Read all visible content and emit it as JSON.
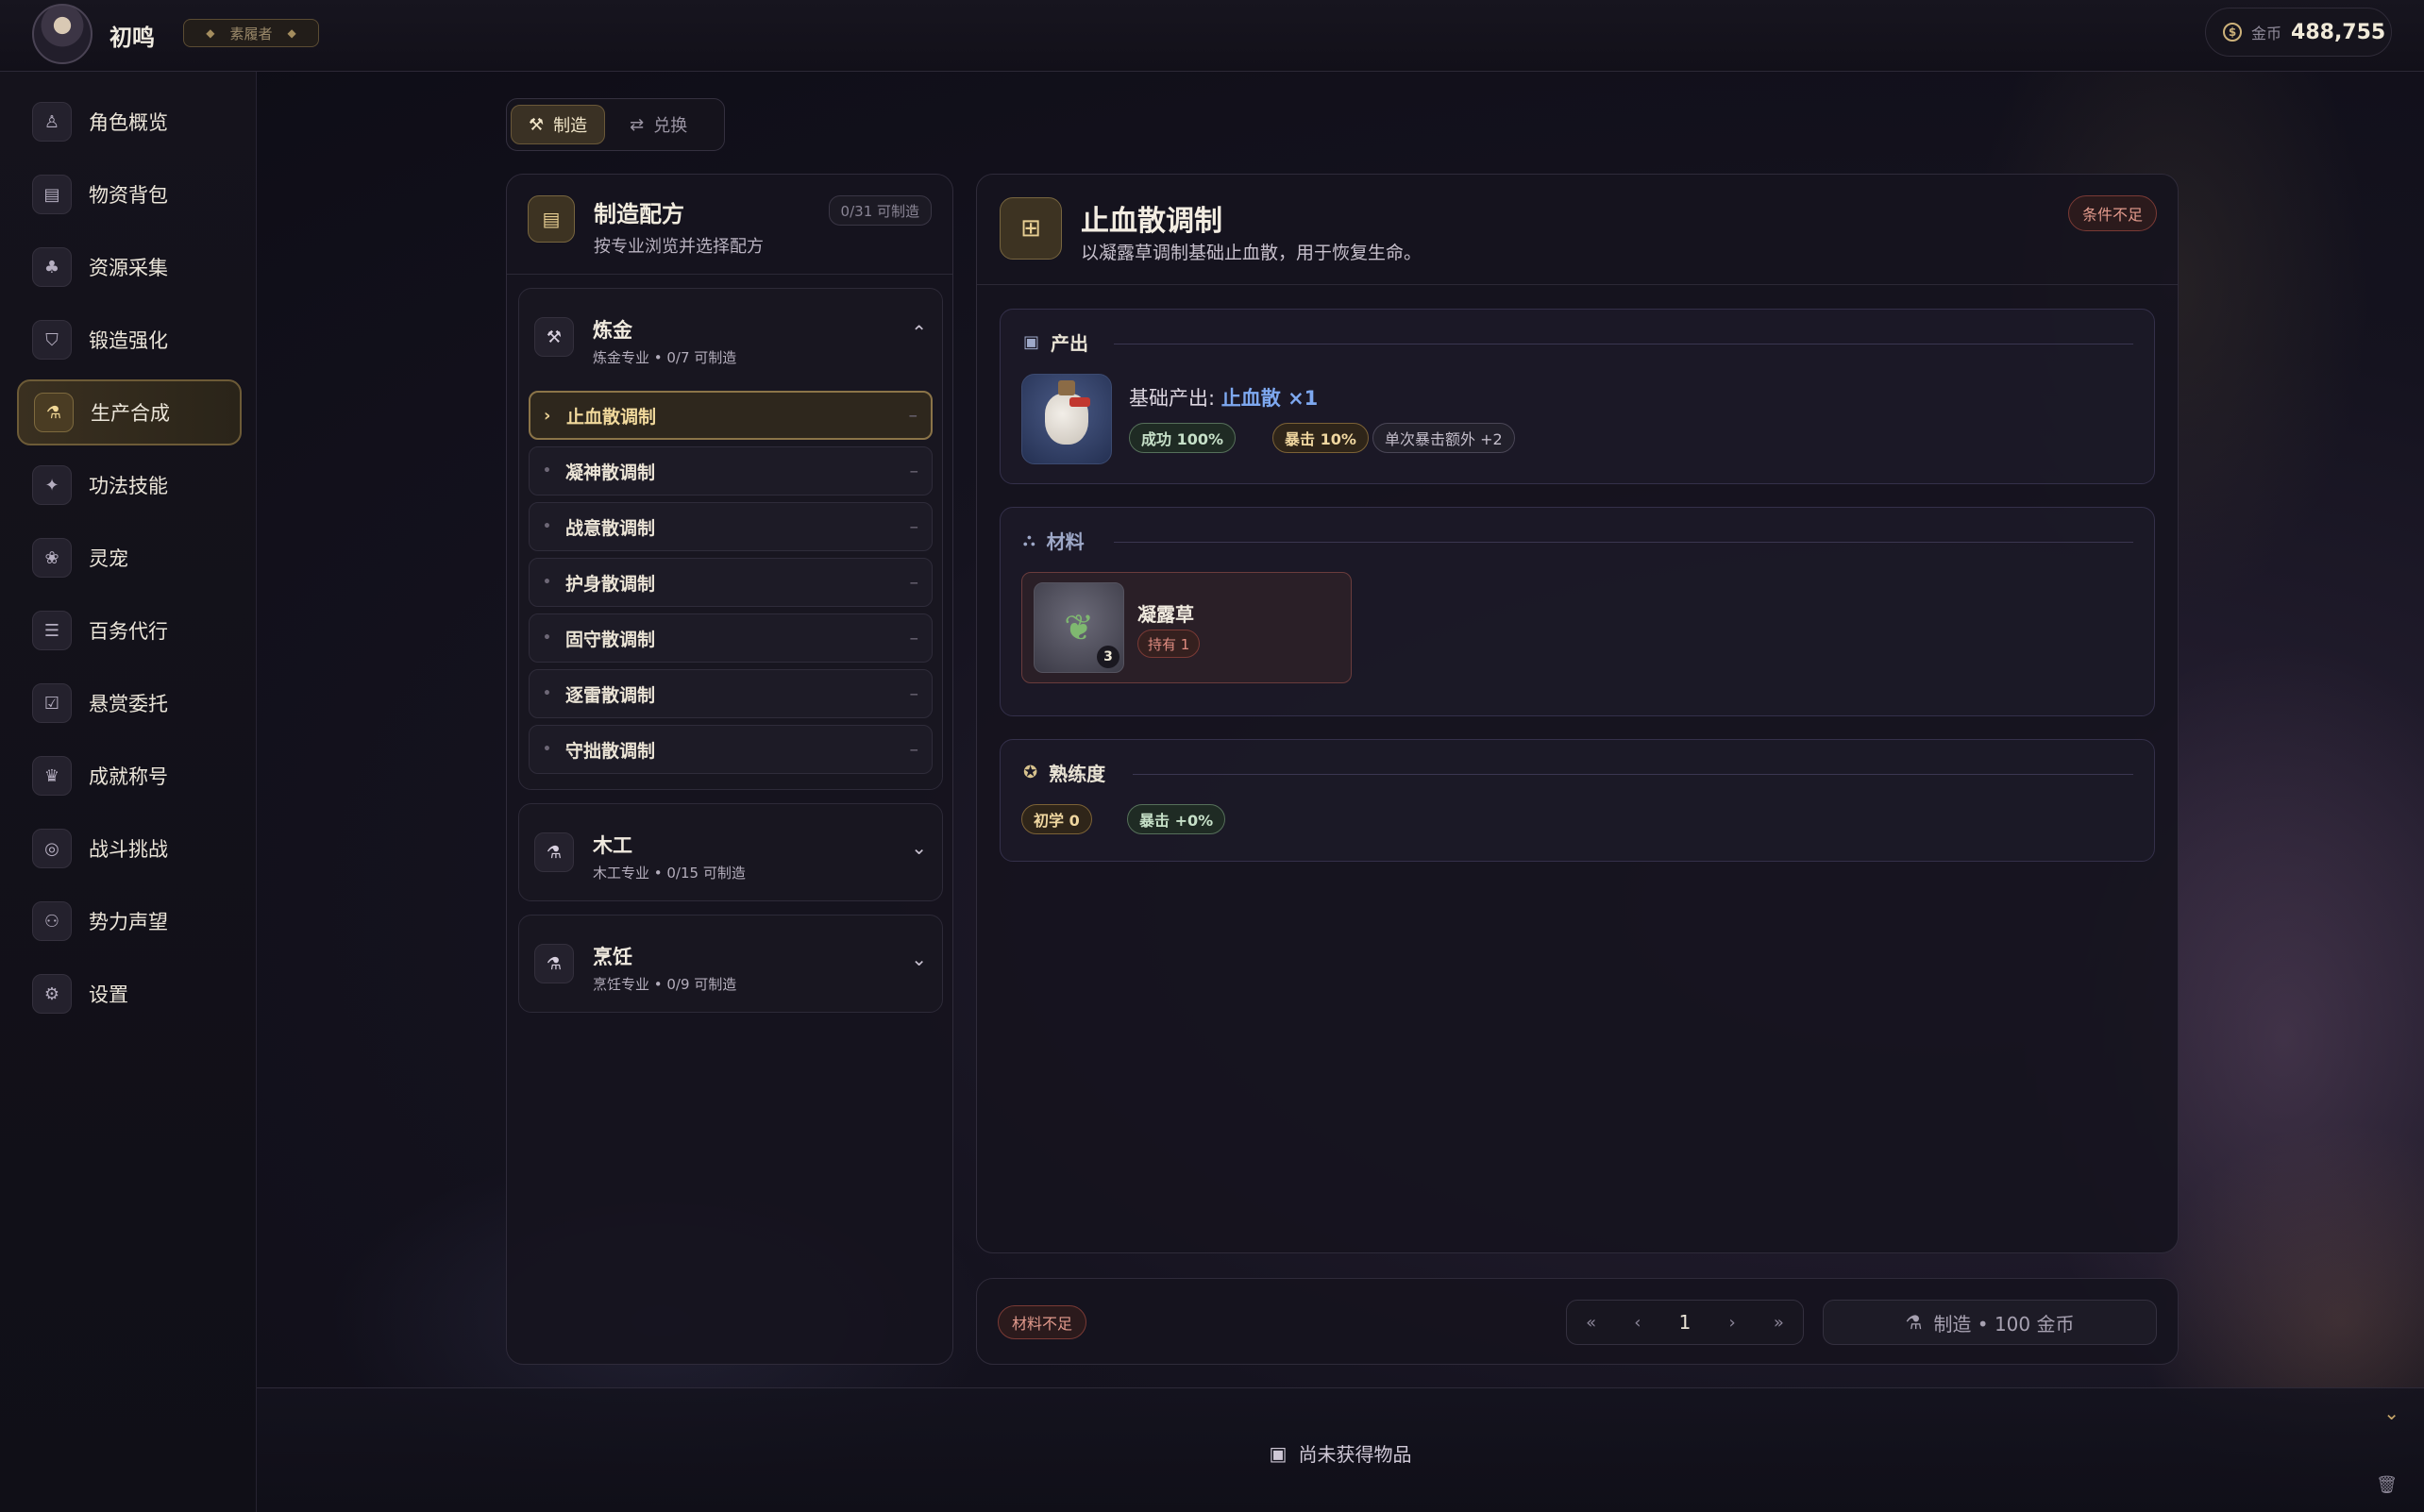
{
  "header": {
    "player_name": "初鸣",
    "player_title": "素履者",
    "gold_label": "金币",
    "gold_value": "488,755"
  },
  "sidebar": {
    "items": [
      {
        "label": "角色概览",
        "icon": "user-icon"
      },
      {
        "label": "物资背包",
        "icon": "bag-icon"
      },
      {
        "label": "资源采集",
        "icon": "gather-icon"
      },
      {
        "label": "锻造强化",
        "icon": "shield-icon"
      },
      {
        "label": "生产合成",
        "icon": "flask-icon"
      },
      {
        "label": "功法技能",
        "icon": "sparkle-icon"
      },
      {
        "label": "灵宠",
        "icon": "paw-icon"
      },
      {
        "label": "百务代行",
        "icon": "list-check-icon"
      },
      {
        "label": "悬赏委托",
        "icon": "clipboard-icon"
      },
      {
        "label": "成就称号",
        "icon": "trophy-icon"
      },
      {
        "label": "战斗挑战",
        "icon": "target-icon"
      },
      {
        "label": "势力声望",
        "icon": "group-icon"
      },
      {
        "label": "设置",
        "icon": "gear-icon"
      }
    ],
    "active_index": 4
  },
  "tabs": [
    {
      "label": "制造",
      "active": true
    },
    {
      "label": "兑换",
      "active": false
    }
  ],
  "recipes_panel": {
    "title": "制造配方",
    "subtitle": "按专业浏览并选择配方",
    "count": "0/31 可制造",
    "categories": [
      {
        "name": "炼金",
        "meta": "炼金专业 • 0/7 可制造",
        "expanded": true,
        "recipes": [
          "止血散调制",
          "凝神散调制",
          "战意散调制",
          "护身散调制",
          "固守散调制",
          "逐雷散调制",
          "守拙散调制"
        ],
        "recipe_status": "–"
      },
      {
        "name": "木工",
        "meta": "木工专业 • 0/15 可制造",
        "expanded": false
      },
      {
        "name": "烹饪",
        "meta": "烹饪专业 • 0/9 可制造",
        "expanded": false
      }
    ]
  },
  "detail": {
    "title": "止血散调制",
    "description": "以凝露草调制基础止血散，用于恢复生命。",
    "status": "条件不足",
    "output": {
      "section_label": "产出",
      "base_label": "基础产出:",
      "item": "止血散 ×1",
      "chips": [
        "成功 100%",
        "暴击 10%",
        "单次暴击额外 +2"
      ]
    },
    "materials": {
      "section_label": "材料",
      "items": [
        {
          "name": "凝露草",
          "required": "3",
          "held": "持有 1"
        }
      ]
    },
    "proficiency": {
      "section_label": "熟练度",
      "chips": [
        "初学 0",
        "暴击 +0%"
      ]
    }
  },
  "bottom_bar": {
    "status": "材料不足",
    "page": "1",
    "craft_label": "制造 • 100 金币"
  },
  "drawer": {
    "empty_text": "尚未获得物品"
  },
  "colors": {
    "accent_gold": "#e8cf93",
    "warning_red": "#e29a8c",
    "link_blue": "#7ea8f0"
  }
}
